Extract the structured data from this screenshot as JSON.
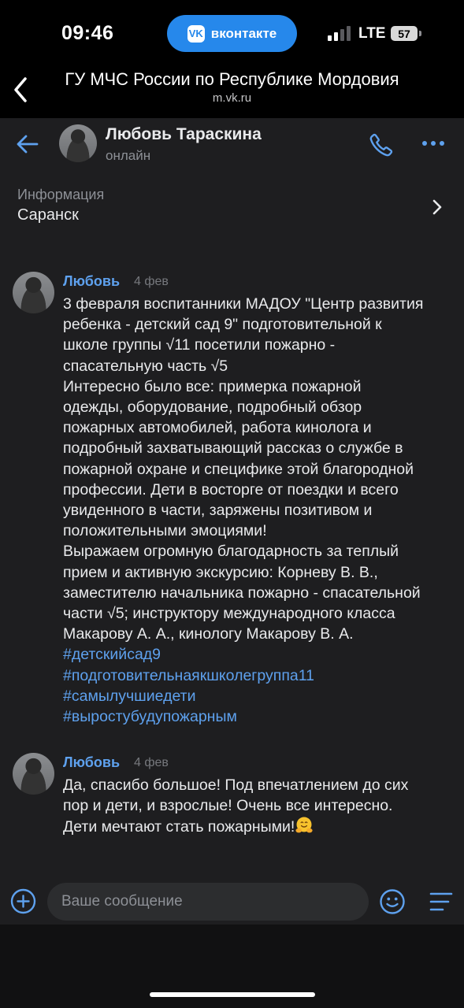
{
  "status_bar": {
    "time": "09:46",
    "app_pill": "вконтакте",
    "app_logo": "VK",
    "network": "LTE",
    "battery": "57"
  },
  "browser": {
    "title": "ГУ МЧС России по Республике Мордовия",
    "url": "m.vk.ru"
  },
  "chat_header": {
    "name": "Любовь Тараскина",
    "status": "онлайн"
  },
  "info": {
    "label": "Информация",
    "value": "Саранск"
  },
  "messages": [
    {
      "author": "Любовь",
      "date": "4 фев",
      "lines": [
        "3 февраля воспитанники МАДОУ \"Центр развития",
        "ребенка - детский сад 9\" подготовительной к",
        "школе группы √11 посетили пожарно -",
        "спасательную часть √5",
        "Интересно было все: примерка пожарной",
        "одежды, оборудование, подробный обзор",
        "пожарных автомобилей, работа кинолога и",
        "подробный захватывающий рассказ о службе в",
        "пожарной охране и специфике этой благородной",
        "профессии. Дети в восторге от поездки и всего",
        "увиденного в части, заряжены позитивом и",
        "положительными эмоциями!",
        "Выражаем огромную благодарность за теплый",
        "прием и активную экскурсию: Корневу В. В.,",
        "заместителю начальника пожарно - спасательной",
        "части √5; инструктору международного класса",
        "Макарову А. А., кинологу Макарову В. А."
      ],
      "hashtags": [
        "#детскийсад9",
        "#подготовительнаякшколегруппа11",
        "#самылучшиедети",
        "#выростубудупожарным"
      ]
    },
    {
      "author": "Любовь",
      "date": "4 фев",
      "lines": [
        "Да, спасибо большое! Под впечатлением до сих",
        "пор и дети, и взрослые! Очень все интересно.",
        "Дети мечтают стать пожарными!"
      ],
      "emoji": "hugging-face-emoji"
    }
  ],
  "composer": {
    "placeholder": "Ваше сообщение"
  },
  "colors": {
    "background": "#1e1e20",
    "accent": "#5ea1ee",
    "vk_blue": "#2688eb",
    "text": "#e9eaec",
    "secondary": "#8d9096"
  },
  "icons": [
    "browser-back-chevron-icon",
    "back-arrow-icon",
    "phone-icon",
    "more-dots-icon",
    "chevron-right-icon",
    "add-attachment-icon",
    "emoji-icon",
    "menu-lines-icon"
  ]
}
